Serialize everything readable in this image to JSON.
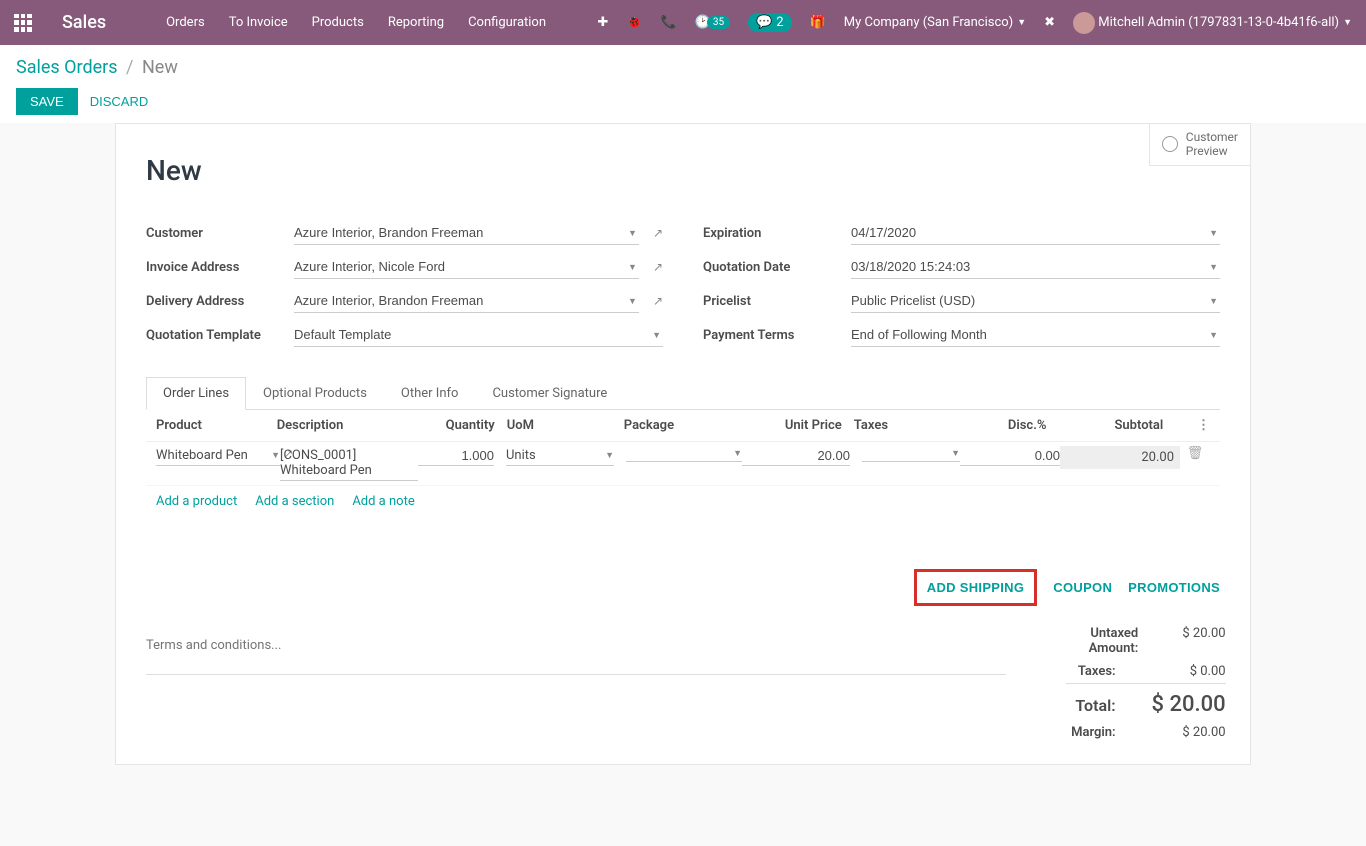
{
  "brand": "Sales",
  "nav": [
    "Orders",
    "To Invoice",
    "Products",
    "Reporting",
    "Configuration"
  ],
  "systray": {
    "activity_count": "35",
    "msg_count": "2",
    "company": "My Company (San Francisco)",
    "user": "Mitchell Admin (1797831-13-0-4b41f6-all)"
  },
  "breadcrumb": {
    "root": "Sales Orders",
    "current": "New"
  },
  "actions": {
    "save": "SAVE",
    "discard": "DISCARD"
  },
  "preview": {
    "line1": "Customer",
    "line2": "Preview"
  },
  "form": {
    "title": "New",
    "labels": {
      "customer": "Customer",
      "invoice_addr": "Invoice Address",
      "delivery_addr": "Delivery Address",
      "quote_tpl": "Quotation Template",
      "expiration": "Expiration",
      "quote_date": "Quotation Date",
      "pricelist": "Pricelist",
      "pay_terms": "Payment Terms"
    },
    "values": {
      "customer": "Azure Interior, Brandon Freeman",
      "invoice_addr": "Azure Interior, Nicole Ford",
      "delivery_addr": "Azure Interior, Brandon Freeman",
      "quote_tpl": "Default Template",
      "expiration": "04/17/2020",
      "quote_date": "03/18/2020 15:24:03",
      "pricelist": "Public Pricelist (USD)",
      "pay_terms": "End of Following Month"
    }
  },
  "tabs": [
    "Order Lines",
    "Optional Products",
    "Other Info",
    "Customer Signature"
  ],
  "table": {
    "headers": {
      "product": "Product",
      "desc": "Description",
      "qty": "Quantity",
      "uom": "UoM",
      "pkg": "Package",
      "price": "Unit Price",
      "tax": "Taxes",
      "disc": "Disc.%",
      "sub": "Subtotal"
    },
    "row": {
      "product": "Whiteboard Pen",
      "desc": "[CONS_0001] Whiteboard Pen",
      "qty": "1.000",
      "uom": "Units",
      "pkg": "",
      "price": "20.00",
      "tax": "",
      "disc": "0.00",
      "sub": "20.00"
    },
    "adds": {
      "product": "Add a product",
      "section": "Add a section",
      "note": "Add a note"
    }
  },
  "bottom_actions": {
    "shipping": "ADD SHIPPING",
    "coupon": "COUPON",
    "promotions": "PROMOTIONS"
  },
  "terms_placeholder": "Terms and conditions...",
  "totals": {
    "untaxed_label": "Untaxed Amount:",
    "untaxed_val": "$ 20.00",
    "taxes_label": "Taxes:",
    "taxes_val": "$ 0.00",
    "total_label": "Total:",
    "total_val": "$ 20.00",
    "margin_label": "Margin:",
    "margin_val": "$ 20.00"
  }
}
